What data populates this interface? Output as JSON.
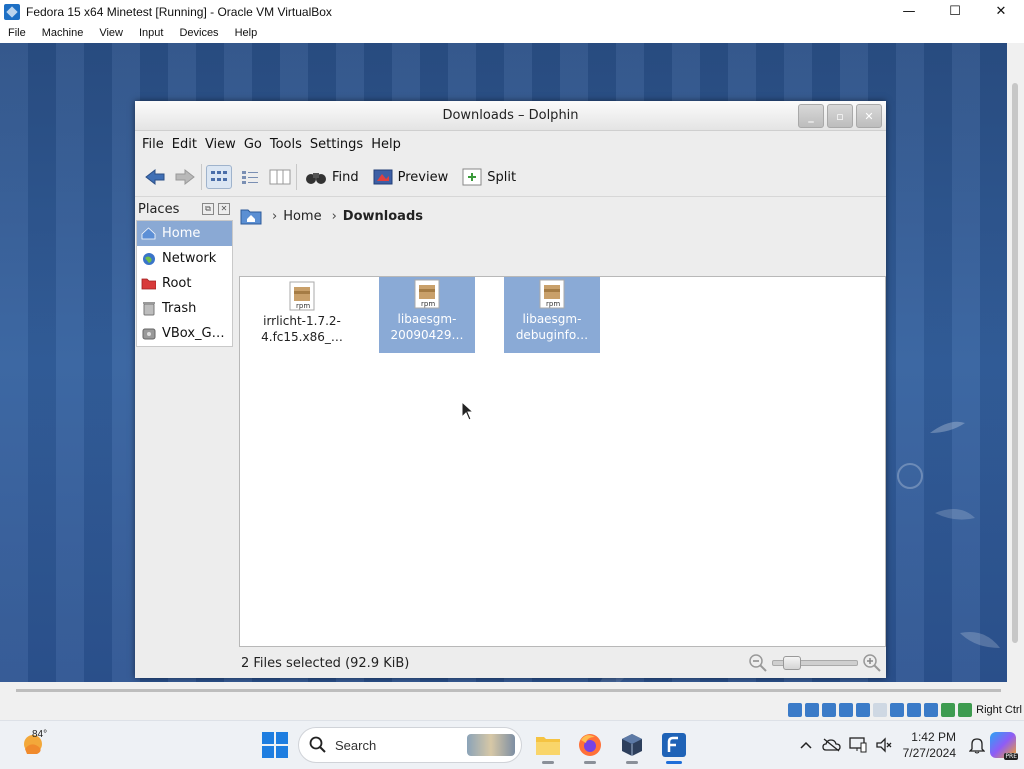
{
  "host": {
    "title": "Fedora 15 x64 Minetest [Running] - Oracle VM VirtualBox",
    "controls": {
      "minimize": "—",
      "maximize": "☐",
      "close": "✕"
    },
    "menu": [
      "File",
      "Machine",
      "View",
      "Input",
      "Devices",
      "Help"
    ],
    "host_key": "Right Ctrl"
  },
  "dolphin": {
    "title": "Downloads – Dolphin",
    "menu": [
      "File",
      "Edit",
      "View",
      "Go",
      "Tools",
      "Settings",
      "Help"
    ],
    "toolbar": {
      "find": "Find",
      "preview": "Preview",
      "split": "Split"
    },
    "places": {
      "header": "Places",
      "items": [
        {
          "label": "Home",
          "icon": "home-icon"
        },
        {
          "label": "Network",
          "icon": "network-icon"
        },
        {
          "label": "Root",
          "icon": "folder-red-icon"
        },
        {
          "label": "Trash",
          "icon": "trash-icon"
        },
        {
          "label": "VBox_G…",
          "icon": "drive-icon"
        }
      ]
    },
    "breadcrumb": {
      "home": "Home",
      "current": "Downloads"
    },
    "files": [
      {
        "line1": "irrlicht-1.7.2-",
        "line2": "4.fc15.x86_…",
        "type": "rpm"
      },
      {
        "line1": "libaesgm-",
        "line2": "20090429…",
        "type": "rpm"
      },
      {
        "line1": "libaesgm-",
        "line2": "debuginfo…",
        "type": "rpm"
      }
    ],
    "status": "2 Files selected (92.9 KiB)"
  },
  "taskbar": {
    "weather_temp": "84°",
    "search_placeholder": "Search",
    "time": "1:42 PM",
    "date": "7/27/2024",
    "copilot_badge": "PRE"
  },
  "colors": {
    "selection": "#8aaad6",
    "desktop": "#2f5a97",
    "windows_accent": "#1e7de0"
  }
}
